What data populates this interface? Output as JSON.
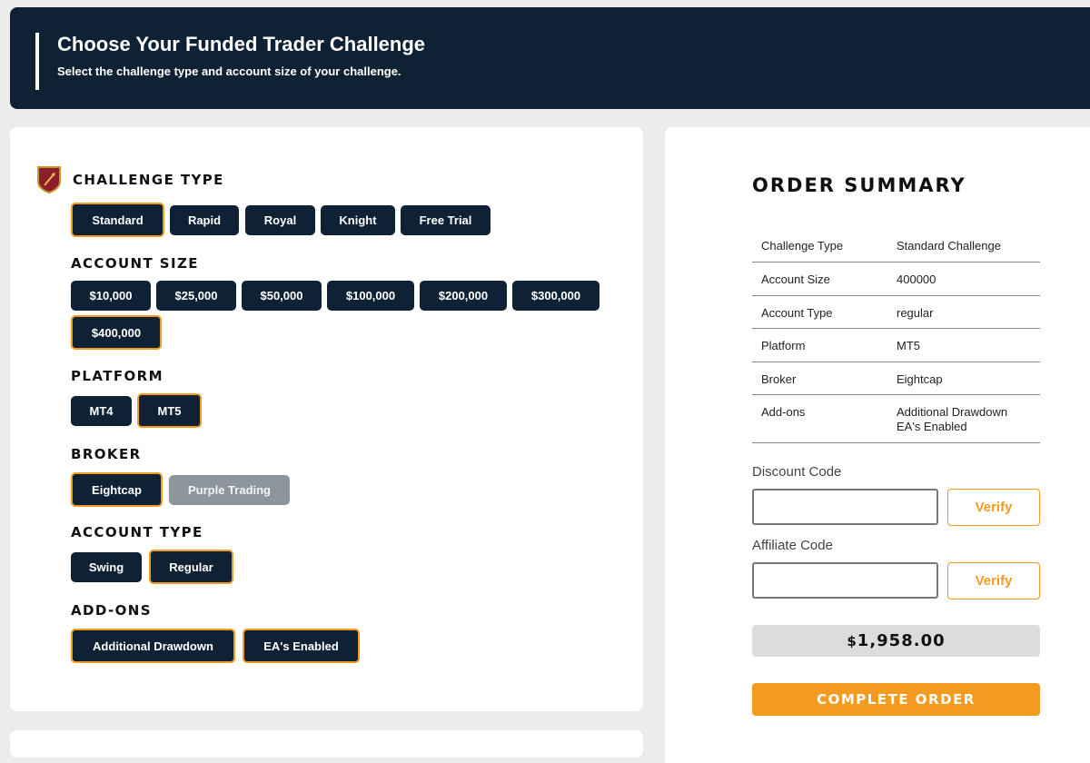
{
  "header": {
    "title": "Choose Your Funded Trader Challenge",
    "subtitle": "Select the challenge type and account size of your challenge."
  },
  "colors": {
    "navy": "#0e2135",
    "accent": "#f39a1f",
    "disabled": "#8e959c",
    "shield_red": "#8c1d2c"
  },
  "challenge_type": {
    "title": "CHALLENGE TYPE",
    "icon": "shield-icon",
    "options": [
      "Standard",
      "Rapid",
      "Royal",
      "Knight",
      "Free Trial"
    ],
    "selected": "Standard"
  },
  "account_size": {
    "title": "ACCOUNT SIZE",
    "options": [
      "$10,000",
      "$25,000",
      "$50,000",
      "$100,000",
      "$200,000",
      "$300,000",
      "$400,000"
    ],
    "selected": "$400,000"
  },
  "platform": {
    "title": "PLATFORM",
    "options": [
      "MT4",
      "MT5"
    ],
    "selected": "MT5"
  },
  "broker": {
    "title": "BROKER",
    "options": [
      "Eightcap",
      "Purple Trading"
    ],
    "selected": "Eightcap",
    "disabled": "Purple Trading"
  },
  "account_type": {
    "title": "ACCOUNT TYPE",
    "options": [
      "Swing",
      "Regular"
    ],
    "selected": "Regular"
  },
  "addons": {
    "title": "ADD-ONS",
    "options": [
      "Additional Drawdown",
      "EA's Enabled"
    ],
    "selected": [
      "Additional Drawdown",
      "EA's Enabled"
    ]
  },
  "summary": {
    "title": "ORDER SUMMARY",
    "rows": [
      {
        "key": "Challenge Type",
        "value": "Standard Challenge"
      },
      {
        "key": "Account Size",
        "value": "400000"
      },
      {
        "key": "Account Type",
        "value": "regular"
      },
      {
        "key": "Platform",
        "value": "MT5"
      },
      {
        "key": "Broker",
        "value": "Eightcap"
      },
      {
        "key": "Add-ons",
        "value": "Additional Drawdown",
        "value2": "EA's Enabled"
      }
    ],
    "discount_label": "Discount Code",
    "affiliate_label": "Affiliate Code",
    "discount_value": "",
    "affiliate_value": "",
    "verify_label": "Verify",
    "currency_symbol": "$",
    "total": "1,958.00",
    "complete_label": "COMPLETE ORDER"
  }
}
